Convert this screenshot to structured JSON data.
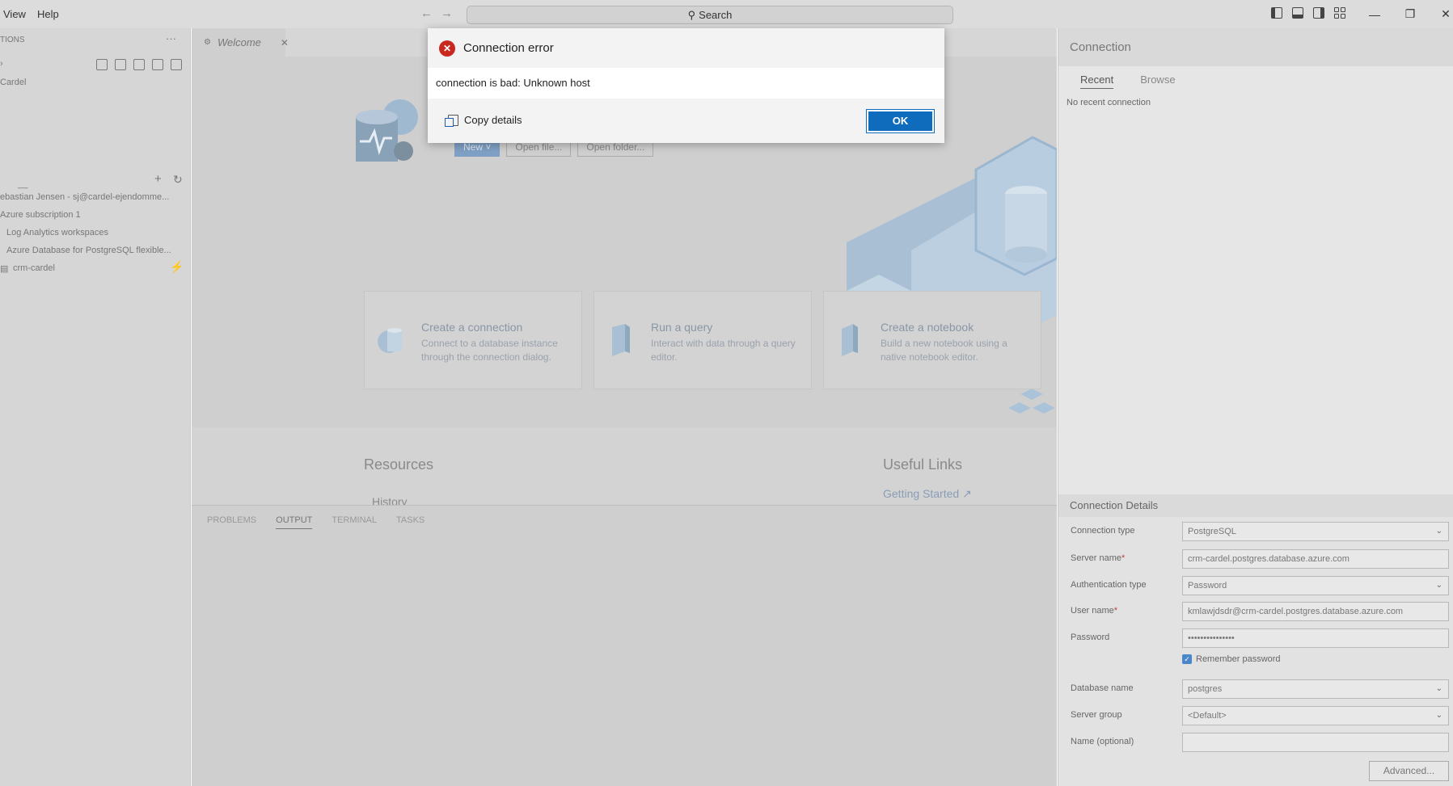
{
  "titlebar": {
    "menu": [
      "View",
      "Help"
    ],
    "search_label": "Search"
  },
  "sidebar": {
    "section_title": "TIONS",
    "more": "···",
    "server_label": "Cardel",
    "account": "ebastian Jensen - sj@cardel-ejendomme...",
    "subscription": "Azure subscription 1",
    "log_analytics": "Log Analytics workspaces",
    "azure_pg": "Azure Database for PostgreSQL flexible...",
    "server_node": "crm-cardel"
  },
  "editor": {
    "tab_label": "Welcome",
    "buttons": {
      "new": "New",
      "open_file": "Open file...",
      "open_folder": "Open folder..."
    },
    "cards": [
      {
        "title": "Create a connection",
        "desc": "Connect to a database instance through the connection dialog."
      },
      {
        "title": "Run a query",
        "desc": "Interact with data through a query editor."
      },
      {
        "title": "Create a notebook",
        "desc": "Build a new notebook using a native notebook editor."
      }
    ],
    "resources_title": "Resources",
    "history": "History",
    "links_title": "Useful Links",
    "getting_started": "Getting Started",
    "panel_tabs": [
      "PROBLEMS",
      "OUTPUT",
      "TERMINAL",
      "TASKS"
    ]
  },
  "connection": {
    "title": "Connection",
    "tabs": [
      "Recent",
      "Browse"
    ],
    "no_recent": "No recent connection",
    "details_title": "Connection Details",
    "fields": {
      "connection_type": {
        "label": "Connection type",
        "value": "PostgreSQL"
      },
      "server_name": {
        "label": "Server name",
        "value": "crm-cardel.postgres.database.azure.com"
      },
      "auth_type": {
        "label": "Authentication type",
        "value": "Password"
      },
      "user_name": {
        "label": "User name",
        "value": "kmlawjdsdr@crm-cardel.postgres.database.azure.com"
      },
      "password": {
        "label": "Password",
        "value": "•••••••••••••••"
      },
      "remember": {
        "label": "Remember password"
      },
      "database": {
        "label": "Database name",
        "value": "postgres"
      },
      "server_group": {
        "label": "Server group",
        "value": "<Default>"
      },
      "name_optional": {
        "label": "Name (optional)",
        "value": ""
      }
    },
    "required_mark": "*",
    "advanced": "Advanced..."
  },
  "dialog": {
    "title": "Connection error",
    "message": "connection is bad: Unknown host",
    "copy_label": "Copy details",
    "ok_label": "OK"
  }
}
